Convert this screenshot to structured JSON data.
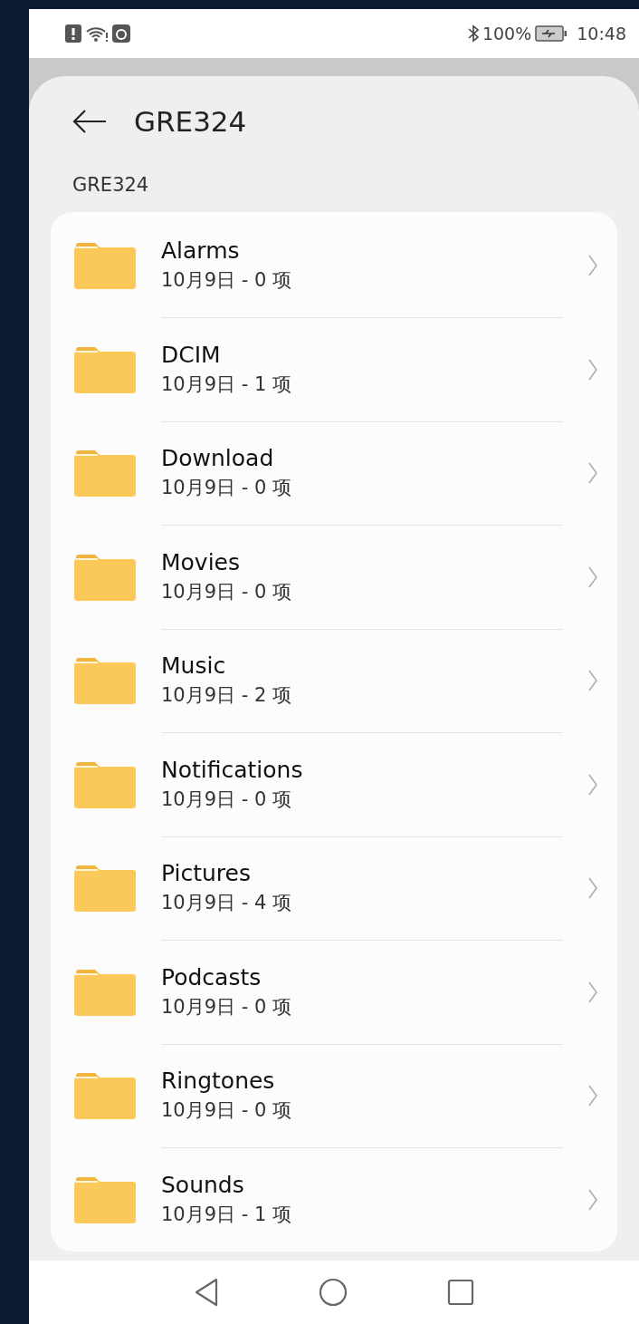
{
  "status_bar": {
    "battery": "100%",
    "time": "10:48"
  },
  "header": {
    "title": "GRE324"
  },
  "section_title": "GRE324",
  "folders": [
    {
      "name": "Alarms",
      "meta": "10月9日 - 0 项"
    },
    {
      "name": "DCIM",
      "meta": "10月9日 - 1 项"
    },
    {
      "name": "Download",
      "meta": "10月9日 - 0 项"
    },
    {
      "name": "Movies",
      "meta": "10月9日 - 0 项"
    },
    {
      "name": "Music",
      "meta": "10月9日 - 2 项"
    },
    {
      "name": "Notifications",
      "meta": "10月9日 - 0 项"
    },
    {
      "name": "Pictures",
      "meta": "10月9日 - 4 项"
    },
    {
      "name": "Podcasts",
      "meta": "10月9日 - 0 项"
    },
    {
      "name": "Ringtones",
      "meta": "10月9日 - 0 项"
    },
    {
      "name": "Sounds",
      "meta": "10月9日 - 1 项"
    }
  ]
}
